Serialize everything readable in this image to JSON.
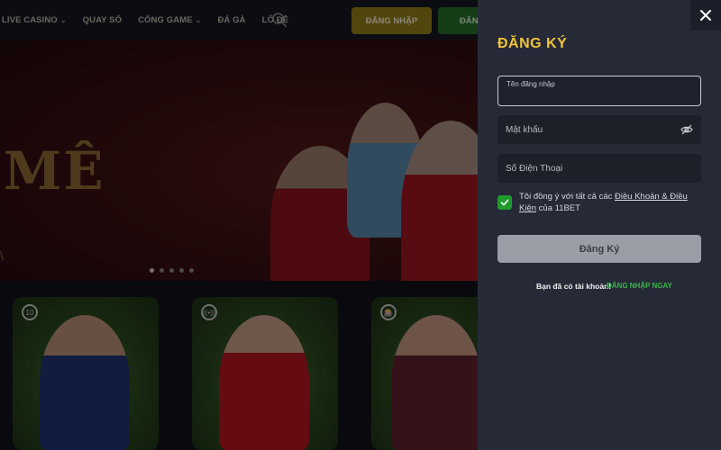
{
  "nav": {
    "items": [
      {
        "label": "LIVE CASINO",
        "has_dropdown": true
      },
      {
        "label": "QUAY SỐ",
        "has_dropdown": false
      },
      {
        "label": "CỔNG GAME",
        "has_dropdown": true
      },
      {
        "label": "ĐÁ GÀ",
        "has_dropdown": false
      },
      {
        "label": "LÔ ĐỀ",
        "has_dropdown": false
      }
    ],
    "search_icon": "search-icon",
    "login_label": "ĐĂNG NHẬP",
    "register_label": "ĐĂNG"
  },
  "banner": {
    "headline": "MÊ",
    "tick": "\\",
    "slide_count": 5,
    "active_slide": 1
  },
  "cards": [
    {
      "badge": "10"
    },
    {
      "badge": "((•))"
    },
    {
      "badge": "🎰"
    }
  ],
  "modal": {
    "title": "ĐĂNG KÝ",
    "username": {
      "label": "Tên đăng nhập",
      "value": ""
    },
    "password": {
      "placeholder": "Mật khẩu",
      "value": ""
    },
    "phone": {
      "placeholder": "Số Điện Thoại",
      "value": ""
    },
    "agree": {
      "checked": true,
      "prefix": "Tôi đồng ý với tất cả các ",
      "link": "Điều Khoản & Điều Kiện",
      "suffix": " của 11BET"
    },
    "submit_label": "Đăng Ký",
    "have_account": "Bạn đã có tài khoản!",
    "login_now": "ĐĂNG NHẬP NGAY"
  },
  "colors": {
    "title_accent": "#f0c33c",
    "login_link": "#3bb54a",
    "checkbox": "#1f9a2c",
    "panel_bg": "#262a36"
  }
}
